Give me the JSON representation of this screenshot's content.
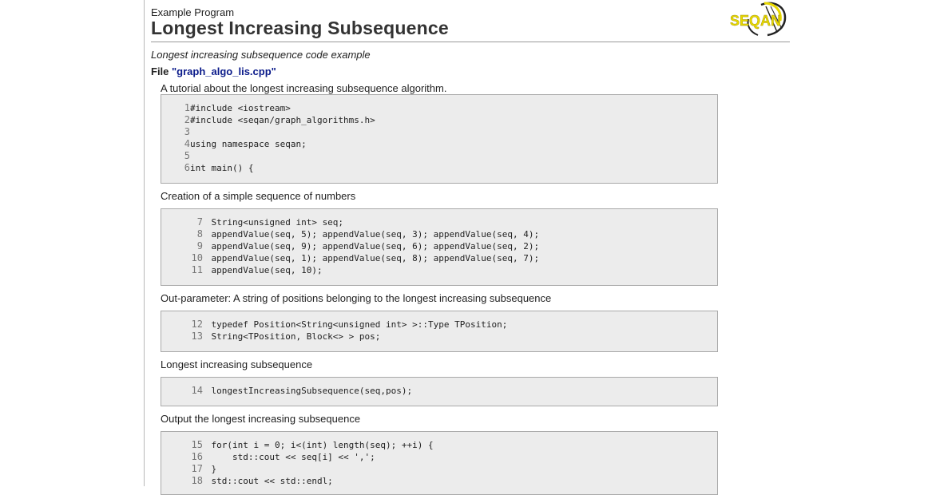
{
  "header": {
    "kicker": "Example Program",
    "title": "Longest Increasing Subsequence",
    "logo_text": "SEQAN",
    "logo_color": "#e8d800"
  },
  "summary": "Longest increasing subsequence code example",
  "file": {
    "label": "File ",
    "name": "\"graph_algo_lis.cpp\""
  },
  "sections": [
    {
      "text": "A tutorial about the longest increasing subsequence algorithm.",
      "lines": [
        {
          "n": "1",
          "code": "#include <iostream>"
        },
        {
          "n": "2",
          "code": "#include <seqan/graph_algorithms.h>"
        },
        {
          "n": "3",
          "code": ""
        },
        {
          "n": "4",
          "code": "using namespace seqan;"
        },
        {
          "n": "5",
          "code": ""
        },
        {
          "n": "6",
          "code": "int main() {"
        }
      ]
    },
    {
      "text": "Creation of a simple sequence of numbers",
      "lines": [
        {
          "n": "7",
          "code": "    String<unsigned int> seq;"
        },
        {
          "n": "8",
          "code": "    appendValue(seq, 5); appendValue(seq, 3); appendValue(seq, 4);"
        },
        {
          "n": "9",
          "code": "    appendValue(seq, 9); appendValue(seq, 6); appendValue(seq, 2);"
        },
        {
          "n": "10",
          "code": "    appendValue(seq, 1); appendValue(seq, 8); appendValue(seq, 7);"
        },
        {
          "n": "11",
          "code": "    appendValue(seq, 10);"
        }
      ]
    },
    {
      "text": "Out-parameter: A string of positions belonging to the longest increasing subsequence",
      "lines": [
        {
          "n": "12",
          "code": "    typedef Position<String<unsigned int> >::Type TPosition;"
        },
        {
          "n": "13",
          "code": "    String<TPosition, Block<> > pos;"
        }
      ]
    },
    {
      "text": "Longest increasing subsequence",
      "lines": [
        {
          "n": "14",
          "code": "    longestIncreasingSubsequence(seq,pos);"
        }
      ]
    },
    {
      "text": "Output the longest increasing subsequence",
      "lines": [
        {
          "n": "15",
          "code": "    for(int i = 0; i<(int) length(seq); ++i) {"
        },
        {
          "n": "16",
          "code": "        std::cout << seq[i] << ',';"
        },
        {
          "n": "17",
          "code": "    }"
        },
        {
          "n": "18",
          "code": "    std::cout << std::endl;"
        }
      ]
    }
  ]
}
